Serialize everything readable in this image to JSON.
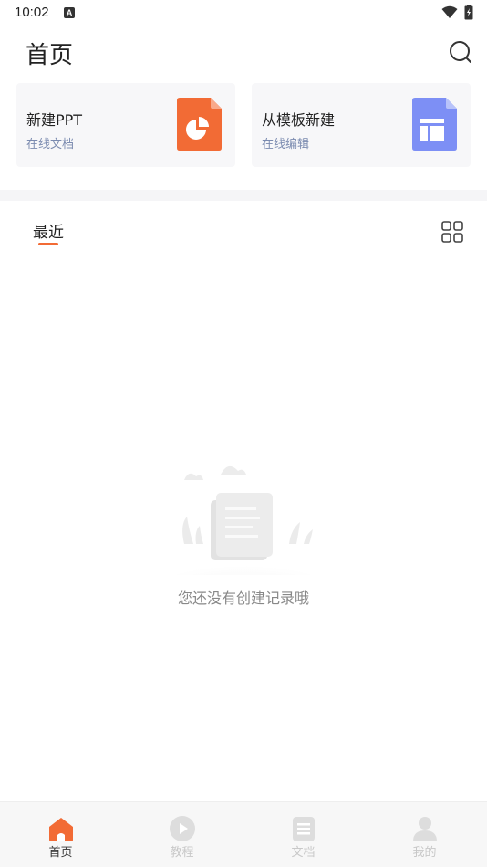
{
  "status_bar": {
    "time": "10:02",
    "notification_letter": "A"
  },
  "header": {
    "title": "首页",
    "search_icon": "search-icon"
  },
  "cards": [
    {
      "title": "新建PPT",
      "subtitle": "在线文档",
      "icon": "ppt-file-icon",
      "color": "#f26b35"
    },
    {
      "title": "从模板新建",
      "subtitle": "在线编辑",
      "icon": "template-file-icon",
      "color": "#7d8ff5"
    }
  ],
  "tabs": {
    "recent_label": "最近",
    "accent": "#f26b35",
    "view_toggle_icon": "grid-view-icon"
  },
  "empty_state": {
    "message": "您还没有创建记录哦",
    "icon": "empty-scroll-illustration"
  },
  "bottom_nav": [
    {
      "label": "首页",
      "icon": "home-icon",
      "active": true,
      "color": "#f26b35"
    },
    {
      "label": "教程",
      "icon": "play-icon",
      "active": false,
      "color": "#d8d8d8"
    },
    {
      "label": "文档",
      "icon": "document-icon",
      "active": false,
      "color": "#d8d8d8"
    },
    {
      "label": "我的",
      "icon": "user-icon",
      "active": false,
      "color": "#d8d8d8"
    }
  ]
}
